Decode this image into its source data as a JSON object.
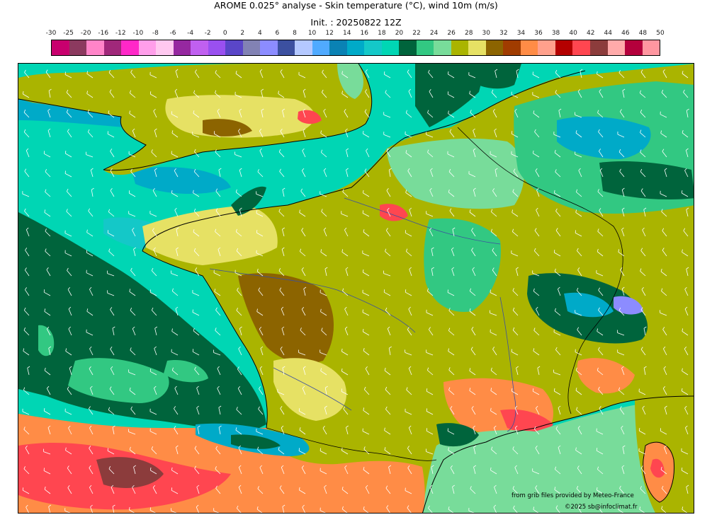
{
  "header": {
    "title": "AROME 0.025° analyse - Skin temperature (°C), wind 10m (m/s)",
    "subtitle": "Init. : 20250822 12Z"
  },
  "colorbar": {
    "labels": [
      "-30",
      "-25",
      "-20",
      "-16",
      "-12",
      "-10",
      "-8",
      "-6",
      "-4",
      "-2",
      "0",
      "2",
      "4",
      "6",
      "8",
      "10",
      "12",
      "14",
      "16",
      "18",
      "20",
      "22",
      "24",
      "26",
      "28",
      "30",
      "32",
      "34",
      "36",
      "38",
      "40",
      "42",
      "44",
      "46",
      "48",
      "50"
    ],
    "colors": [
      "#c8006e",
      "#8c3a5f",
      "#ff84c8",
      "#a0287a",
      "#ff28c8",
      "#ff9eea",
      "#ffc8f0",
      "#9628a0",
      "#c060f0",
      "#9a50f0",
      "#5a46c8",
      "#8282b4",
      "#8c8cff",
      "#3c50a0",
      "#b4c8ff",
      "#50aaff",
      "#0a82b4",
      "#00aac8",
      "#14c8c8",
      "#00d6b4",
      "#00643c",
      "#32c882",
      "#78dc9a",
      "#aab400",
      "#e6e164",
      "#8c6400",
      "#a03c00",
      "#ff8c46",
      "#ffa08c",
      "#b40000",
      "#ff4650",
      "#8c3c3c",
      "#ffaaaa",
      "#b4003c",
      "#ff96a0"
    ]
  },
  "map": {
    "land_colors": {
      "sea_warm": "#00d6b4",
      "sea_cool": "#00aac8",
      "sea_cold": "#00643c",
      "low": "#78dc9a",
      "mid": "#aab400",
      "mid_high": "#e6e164",
      "high": "#8c6400",
      "hot": "#ff8c46",
      "very_hot": "#ff4650"
    }
  },
  "credits": {
    "line1": "from grib files provided by Meteo-France",
    "line2": "©2025 sb@infoclimat.fr"
  }
}
